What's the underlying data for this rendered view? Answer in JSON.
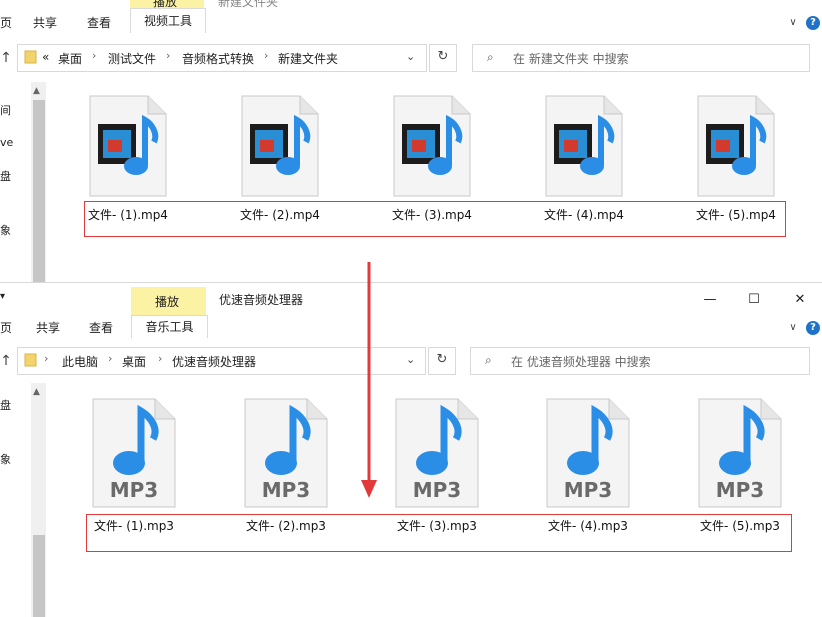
{
  "window_top": {
    "ribbon": {
      "tab_partial": "页",
      "tabs": [
        "共享",
        "查看"
      ],
      "context_group": "播放",
      "context_tab": "视频工具",
      "title_partial": "新建文件夹"
    },
    "address": {
      "prefix": "«",
      "crumbs": [
        "桌面",
        "测试文件",
        "音频格式转换",
        "新建文件夹"
      ],
      "search_placeholder": "在 新建文件夹 中搜索"
    },
    "left_pane": [
      "间",
      "ve",
      "盘",
      "象"
    ],
    "files": [
      "文件- (1).mp4",
      "文件- (2).mp4",
      "文件- (3).mp4",
      "文件- (4).mp4",
      "文件- (5).mp4"
    ]
  },
  "window_bottom": {
    "ribbon": {
      "tab_partial": "页",
      "tabs": [
        "共享",
        "查看"
      ],
      "context_group": "播放",
      "context_tab": "音乐工具",
      "title": "优速音频处理器",
      "window_controls": {
        "minimize": "—",
        "maximize": "☐",
        "close": "✕"
      }
    },
    "address": {
      "crumbs": [
        "此电脑",
        "桌面",
        "优速音频处理器"
      ],
      "search_placeholder": "在 优速音频处理器 中搜索"
    },
    "left_pane": [
      "盘",
      "象"
    ],
    "files": [
      "文件- (1).mp3",
      "文件- (2).mp3",
      "文件- (3).mp3",
      "文件- (4).mp3",
      "文件- (5).mp3"
    ],
    "file_icon_label": "MP3"
  },
  "icons": {
    "up": "arrow-up-icon",
    "refresh": "refresh-icon",
    "search": "search-icon",
    "dropdown": "chevron-down-icon"
  },
  "colors": {
    "context_tab": "#fbf2a4",
    "annotation_red": "#e23a3a",
    "note_blue": "#1e7fd6"
  }
}
